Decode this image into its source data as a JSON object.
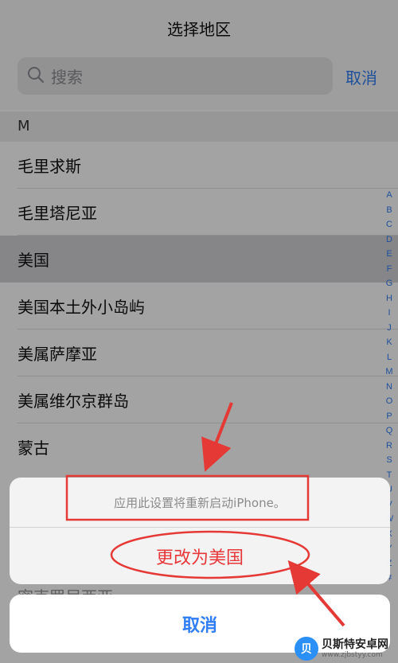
{
  "header": {
    "title": "选择地区"
  },
  "search": {
    "placeholder": "搜索",
    "cancel_label": "取消"
  },
  "section": {
    "letter": "M"
  },
  "regions": [
    {
      "label": "毛里求斯"
    },
    {
      "label": "毛里塔尼亚"
    },
    {
      "label": "美国",
      "selected": true
    },
    {
      "label": "美国本土外小岛屿"
    },
    {
      "label": "美属萨摩亚"
    },
    {
      "label": "美属维尔京群岛"
    },
    {
      "label": "蒙古"
    }
  ],
  "index_letters": [
    "A",
    "B",
    "C",
    "D",
    "E",
    "F",
    "G",
    "H",
    "I",
    "J",
    "K",
    "L",
    "M",
    "N",
    "O",
    "P",
    "Q",
    "R",
    "S",
    "T",
    "U",
    "V",
    "W",
    "X",
    "Y",
    "Z",
    "#"
  ],
  "alert": {
    "message": "应用此设置将重新启动iPhone。",
    "action_label": "更改为美国",
    "cancel_label": "取消"
  },
  "peek_row": "密克罗尼西亚",
  "watermark": {
    "name": "贝斯特安卓网",
    "url": "www.zjbstyy.com"
  },
  "colors": {
    "accent": "#2f7ef5",
    "destructive": "#e8373a",
    "annotation": "#e53935"
  },
  "icons": {
    "search": "search-icon",
    "watermark_logo": "watermark-logo-icon"
  }
}
